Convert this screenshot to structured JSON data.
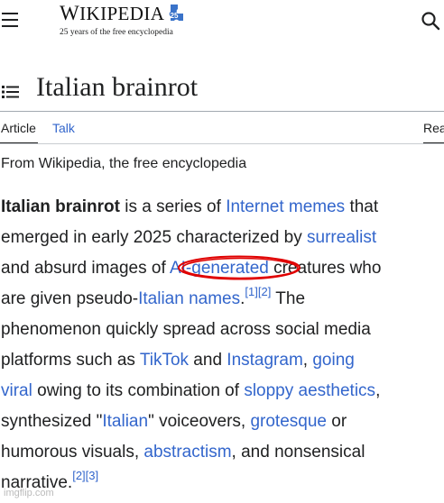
{
  "header": {
    "logo_word_cap": "W",
    "logo_word_rest": "IKIPEDIA",
    "logo_badge": "25",
    "logo_tagline": "25 years of the free encyclopedia"
  },
  "article": {
    "title": "Italian brainrot",
    "subtitle": "From Wikipedia, the free encyclopedia"
  },
  "tabs": {
    "article": "Article",
    "talk": "Talk",
    "read": "Rea"
  },
  "body": {
    "l1_bold": "Italian brainrot",
    "l1_t1": " is a series of ",
    "l1_link1": "Internet memes",
    "l1_t2": " that",
    "l2_t1": "emerged in early 2025 characterized by ",
    "l2_link1": "surrealist",
    "l3_t1": "and absurd images of ",
    "l3_link1": "AI-generated",
    "l3_t2": " creatures who",
    "l4_t1": "are given pseudo-",
    "l4_link1": "Italian names",
    "l4_t2": ".",
    "l4_ref1": "[1]",
    "l4_ref2": "[2]",
    "l4_t3": " The",
    "l5_t1": "phenomenon quickly spread across social media",
    "l6_t1": "platforms such as ",
    "l6_link1": "TikTok",
    "l6_t2": " and ",
    "l6_link2": "Instagram",
    "l6_t3": ", ",
    "l6_link3": "going",
    "l7_link1": "viral",
    "l7_t1": " owing to its combination of ",
    "l7_link2": "sloppy aesthetics",
    "l7_t2": ",",
    "l8_t1": "synthesized \"",
    "l8_link1": "Italian",
    "l8_t2": "\" voiceovers, ",
    "l8_link2": "grotesque",
    "l8_t3": " or",
    "l9_t1": "humorous visuals, ",
    "l9_link1": "abstractism",
    "l9_t2": ", and nonsensical",
    "l10_t1": "narrative.",
    "l10_ref1": "[2]",
    "l10_ref2": "[3]"
  },
  "annotation_color": "#e00000",
  "watermark": "imgflip.com",
  "icons": [
    "menu-icon",
    "search-icon",
    "toc-icon",
    "wikipedia-25-badge-icon"
  ]
}
